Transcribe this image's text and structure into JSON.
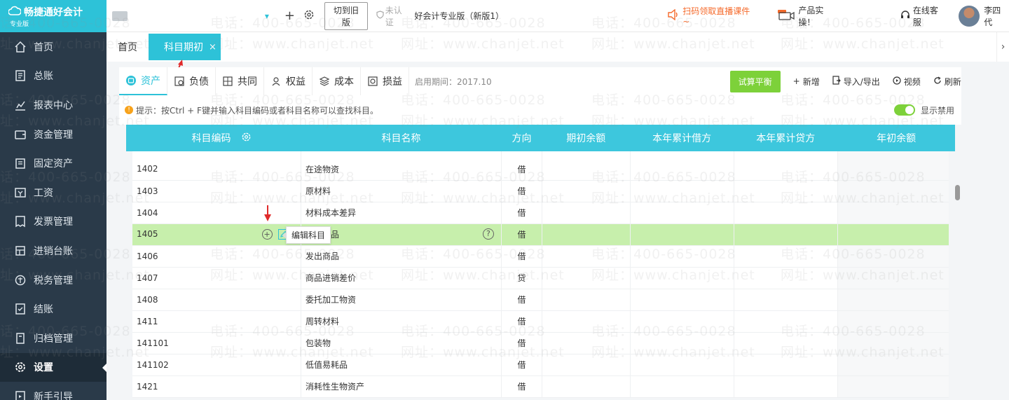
{
  "app": {
    "logo_title": "畅捷通好会计",
    "logo_sub": "专业版"
  },
  "sidebar": {
    "items": [
      {
        "label": "首页",
        "icon": "home-icon"
      },
      {
        "label": "总账",
        "icon": "ledger-icon"
      },
      {
        "label": "报表中心",
        "icon": "report-icon"
      },
      {
        "label": "资金管理",
        "icon": "wallet-icon"
      },
      {
        "label": "固定资产",
        "icon": "asset-icon"
      },
      {
        "label": "工资",
        "icon": "salary-icon"
      },
      {
        "label": "发票管理",
        "icon": "invoice-icon"
      },
      {
        "label": "进销台账",
        "icon": "inventory-icon"
      },
      {
        "label": "税务管理",
        "icon": "tax-icon"
      },
      {
        "label": "结账",
        "icon": "close-account-icon"
      },
      {
        "label": "归档管理",
        "icon": "archive-icon"
      },
      {
        "label": "设置",
        "icon": "gear-icon"
      },
      {
        "label": "新手引导",
        "icon": "guide-icon"
      }
    ],
    "active_index": 11
  },
  "topbar": {
    "switch_old": "切到旧版",
    "auth": "未认证",
    "version": "好会计专业版（新版1）",
    "promo": "扫码领取直播课件~",
    "product": "产品实操！",
    "service": "在线客服",
    "username": "李四代"
  },
  "tabs": {
    "home": "首页",
    "active": "科目期初",
    "close": "×"
  },
  "categories": [
    {
      "label": "资产",
      "icon": "asset-category-icon"
    },
    {
      "label": "负债",
      "icon": "liability-category-icon"
    },
    {
      "label": "共同",
      "icon": "common-category-icon"
    },
    {
      "label": "权益",
      "icon": "equity-category-icon"
    },
    {
      "label": "成本",
      "icon": "cost-category-icon"
    },
    {
      "label": "损益",
      "icon": "profit-loss-category-icon"
    }
  ],
  "period": "启用期间：2017.10",
  "actions": {
    "trial_balance": "试算平衡",
    "add": "新增",
    "import_export": "导入/导出",
    "video": "视频",
    "refresh": "刷新"
  },
  "hint": "提示：按Ctrl + F键并输入科目编码或者科目名称可以查找科目。",
  "show_disabled": "显示禁用",
  "table": {
    "headers": [
      "科目编码",
      "科目名称",
      "方向",
      "期初余额",
      "本年累计借方",
      "本年累计贷方",
      "年初余额"
    ],
    "rows": [
      {
        "code": "1402",
        "name": "在途物资",
        "dir": "借"
      },
      {
        "code": "1403",
        "name": "原材料",
        "dir": "借"
      },
      {
        "code": "1404",
        "name": "材料成本差异",
        "dir": "借"
      },
      {
        "code": "1405",
        "name": "品",
        "dir": "借"
      },
      {
        "code": "1406",
        "name": "发出商品",
        "dir": "借"
      },
      {
        "code": "1407",
        "name": "商品进销差价",
        "dir": "贷"
      },
      {
        "code": "1408",
        "name": "委托加工物资",
        "dir": "借"
      },
      {
        "code": "1411",
        "name": "周转材料",
        "dir": "借"
      },
      {
        "code": "141101",
        "name": "包装物",
        "dir": "借"
      },
      {
        "code": "141102",
        "name": "低值易耗品",
        "dir": "借"
      },
      {
        "code": "1421",
        "name": "消耗性生物资产",
        "dir": "借"
      }
    ],
    "selected_index": 3,
    "tooltip": "编辑科目"
  },
  "watermark": {
    "phone": "电话：400-665-0028",
    "site": "网址：www.chanjet.net"
  },
  "colors": {
    "accent": "#2dc2d8",
    "sidebar": "#2a3a49",
    "primary_button": "#7dd13a",
    "selected_row": "#c7efac"
  }
}
